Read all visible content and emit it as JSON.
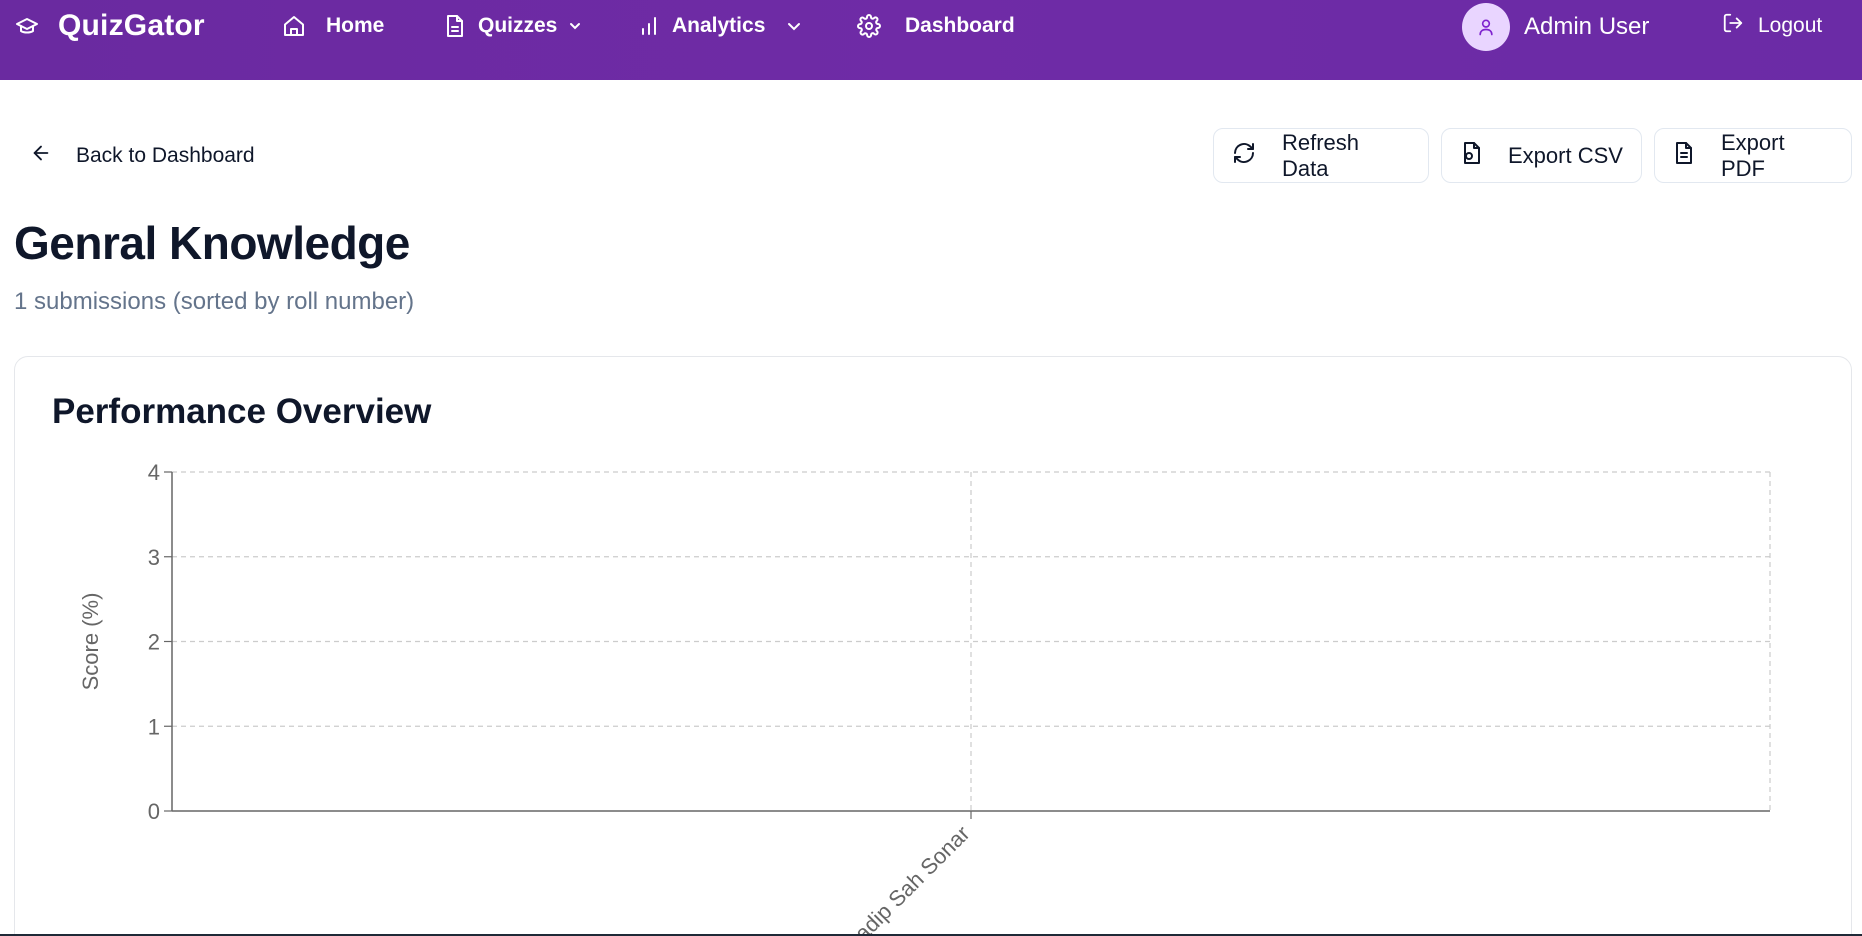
{
  "app": {
    "name": "QuizGator"
  },
  "nav": {
    "home": "Home",
    "quizzes": "Quizzes",
    "analytics": "Analytics",
    "dashboard": "Dashboard"
  },
  "user": {
    "name": "Admin User",
    "logout": "Logout"
  },
  "toolbar": {
    "back": "Back to Dashboard",
    "refresh": "Refresh Data",
    "export_csv": "Export CSV",
    "export_pdf": "Export PDF"
  },
  "page": {
    "title": "Genral Knowledge",
    "subtitle": "1 submissions (sorted by roll number)"
  },
  "card": {
    "title": "Performance Overview"
  },
  "chart_data": {
    "type": "bar",
    "categories": [
      "Pradip Sah Sonar"
    ],
    "series": [
      {
        "values": [
          0
        ]
      }
    ],
    "ylabel": "Score (%)",
    "yticks": [
      0,
      1,
      2,
      3,
      4
    ],
    "ylim": [
      0,
      4
    ],
    "grid": true,
    "colors": {
      "grid": "#cccccc",
      "axis": "#666666",
      "tick_text": "#666666"
    }
  }
}
